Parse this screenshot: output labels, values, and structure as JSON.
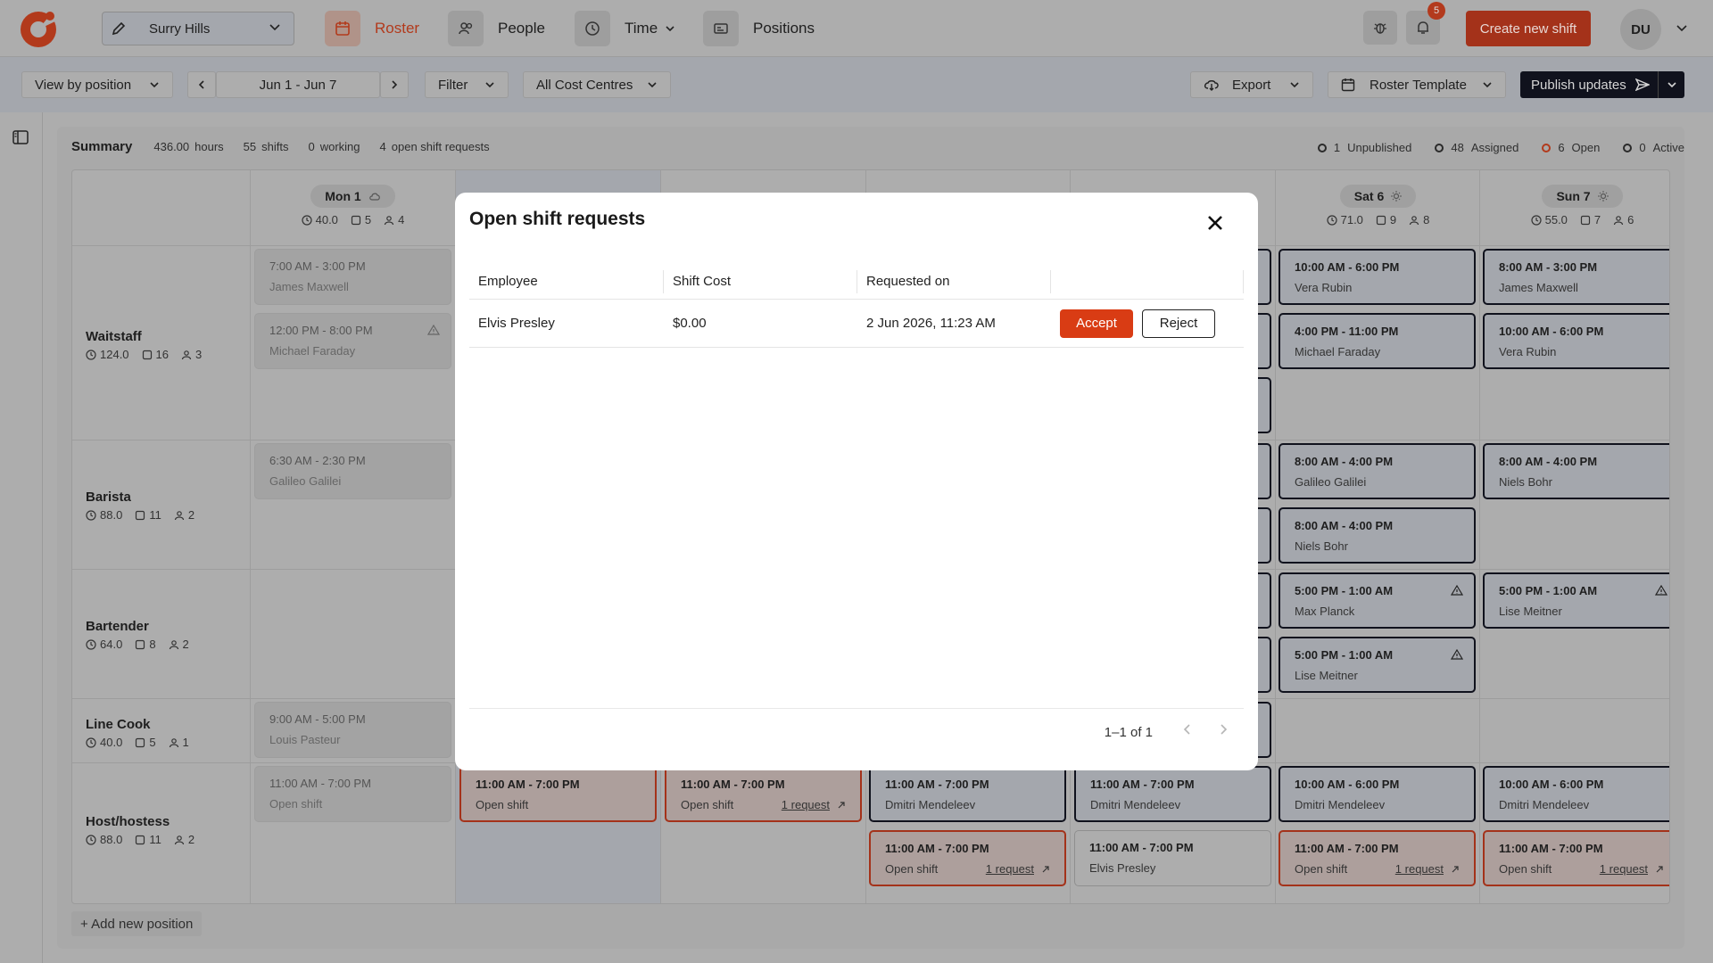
{
  "topnav": {
    "location": "Surry Hills",
    "nav": [
      {
        "label": "Roster",
        "icon": "calendar-icon",
        "active": true
      },
      {
        "label": "People",
        "icon": "people-icon",
        "active": false
      },
      {
        "label": "Time",
        "icon": "clock-icon",
        "active": false
      },
      {
        "label": "Positions",
        "icon": "id-card-icon",
        "active": false
      }
    ],
    "notification_count": "5",
    "create_label": "Create new shift",
    "avatar_initials": "DU"
  },
  "toolbar": {
    "view_by": "View by position",
    "date_range": "Jun 1 - Jun 7",
    "filter": "Filter",
    "cost_centres": "All Cost Centres",
    "export": "Export",
    "roster_template": "Roster Template",
    "publish": "Publish updates"
  },
  "summary": {
    "title": "Summary",
    "hours_value": "436.00",
    "hours_label": "hours",
    "shifts_value": "55",
    "shifts_label": "shifts",
    "working_value": "0",
    "working_label": "working",
    "requests_value": "4",
    "requests_label": "open shift requests"
  },
  "status": {
    "unpublished_count": "1",
    "unpublished_label": "Unpublished",
    "assigned_count": "48",
    "assigned_label": "Assigned",
    "open_count": "6",
    "open_label": "Open",
    "active_count": "0",
    "active_label": "Active",
    "open_color": "#b23a1c"
  },
  "days": [
    {
      "label": "Mon 1",
      "hours": "40.0",
      "shifts": "5",
      "people": "4"
    },
    {
      "label": "Sat 6",
      "hours": "71.0",
      "shifts": "9",
      "people": "8"
    },
    {
      "label": "Sun 7",
      "hours": "55.0",
      "shifts": "7",
      "people": "6"
    }
  ],
  "positions": [
    {
      "name": "Waitstaff",
      "hours": "124.0",
      "shifts": "16",
      "people": "3"
    },
    {
      "name": "Barista",
      "hours": "88.0",
      "shifts": "11",
      "people": "2"
    },
    {
      "name": "Bartender",
      "hours": "64.0",
      "shifts": "8",
      "people": "2"
    },
    {
      "name": "Line Cook",
      "hours": "40.0",
      "shifts": "5",
      "people": "1"
    },
    {
      "name": "Host/hostess",
      "hours": "88.0",
      "shifts": "11",
      "people": "2"
    }
  ],
  "shifts": {
    "mon_wait_1": {
      "time": "7:00 AM - 3:00 PM",
      "who": "James Maxwell"
    },
    "mon_wait_2": {
      "time": "12:00 PM - 8:00 PM",
      "who": "Michael Faraday"
    },
    "mon_barista": {
      "time": "6:30 AM - 2:30 PM",
      "who": "Galileo Galilei"
    },
    "mon_cook": {
      "time": "9:00 AM - 5:00 PM",
      "who": "Louis Pasteur"
    },
    "mon_host": {
      "time": "11:00 AM - 7:00 PM",
      "who": "Open shift"
    },
    "tue_host": {
      "time": "11:00 AM - 7:00 PM",
      "who": "Open shift"
    },
    "wed_host": {
      "time": "11:00 AM - 7:00 PM",
      "who": "Open shift",
      "req": "1 request"
    },
    "thu_host_1": {
      "time": "11:00 AM - 7:00 PM",
      "who": "Dmitri Mendeleev"
    },
    "thu_host_2": {
      "time": "11:00 AM - 7:00 PM",
      "who": "Open shift",
      "req": "1 request"
    },
    "fri_host_1": {
      "time": "11:00 AM - 7:00 PM",
      "who": "Dmitri Mendeleev"
    },
    "fri_host_2": {
      "time": "11:00 AM - 7:00 PM",
      "who": "Elvis Presley"
    },
    "sat_wait_1": {
      "time": "10:00 AM - 6:00 PM",
      "who": "Vera Rubin"
    },
    "sat_wait_2": {
      "time": "4:00 PM - 11:00 PM",
      "who": "Michael Faraday"
    },
    "sat_barista_1": {
      "time": "8:00 AM - 4:00 PM",
      "who": "Galileo Galilei"
    },
    "sat_barista_2": {
      "time": "8:00 AM - 4:00 PM",
      "who": "Niels Bohr"
    },
    "sat_bar_1": {
      "time": "5:00 PM - 1:00 AM",
      "who": "Max Planck"
    },
    "sat_bar_2": {
      "time": "5:00 PM - 1:00 AM",
      "who": "Lise Meitner"
    },
    "sat_host_1": {
      "time": "10:00 AM - 6:00 PM",
      "who": "Dmitri Mendeleev"
    },
    "sat_host_2": {
      "time": "11:00 AM - 7:00 PM",
      "who": "Open shift",
      "req": "1 request"
    },
    "sun_wait_1": {
      "time": "8:00 AM - 3:00 PM",
      "who": "James Maxwell"
    },
    "sun_wait_2": {
      "time": "10:00 AM - 6:00 PM",
      "who": "Vera Rubin"
    },
    "sun_barista": {
      "time": "8:00 AM - 4:00 PM",
      "who": "Niels Bohr"
    },
    "sun_bar": {
      "time": "5:00 PM - 1:00 AM",
      "who": "Lise Meitner"
    },
    "sun_host_1": {
      "time": "10:00 AM - 6:00 PM",
      "who": "Dmitri Mendeleev"
    },
    "sun_host_2": {
      "time": "11:00 AM - 7:00 PM",
      "who": "Open shift",
      "req": "1 request"
    }
  },
  "add_position": "+ Add new position",
  "modal": {
    "title": "Open shift requests",
    "columns": [
      "Employee",
      "Shift Cost",
      "Requested on",
      ""
    ],
    "rows": [
      {
        "employee": "Elvis Presley",
        "cost": "$0.00",
        "requested_on": "2 Jun 2026, 11:23 AM"
      }
    ],
    "accept": "Accept",
    "reject": "Reject",
    "pagination": "1–1 of 1",
    "accent": "#d93c14"
  }
}
